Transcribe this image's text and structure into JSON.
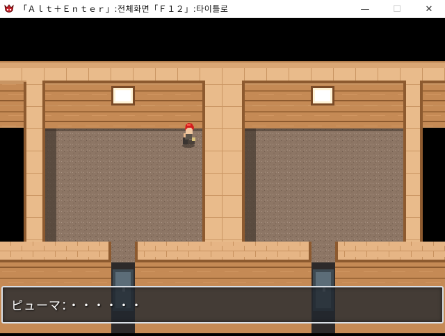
{
  "window": {
    "title": "「Ａｌｔ＋Ｅｎｔｅｒ」:전체화면「Ｆ１２」:타이틀로",
    "minimize_glyph": "—",
    "maximize_glyph": "☐",
    "close_glyph": "✕"
  },
  "colors": {
    "wall_light": "#e8b887",
    "wall_mid": "#c8915e",
    "wall_dark": "#8a5530",
    "floor": "#8c7564",
    "void": "#000000",
    "dialog_bg": "#20262e",
    "dialog_border": "#d9dfe6"
  },
  "dialog": {
    "text": "ピューマ：・・・・・・"
  },
  "icons": {
    "app": "red-demon-icon",
    "character": "red-haired-hero-sprite",
    "door": "metal-door-icon",
    "lamp": "wall-light-icon"
  }
}
